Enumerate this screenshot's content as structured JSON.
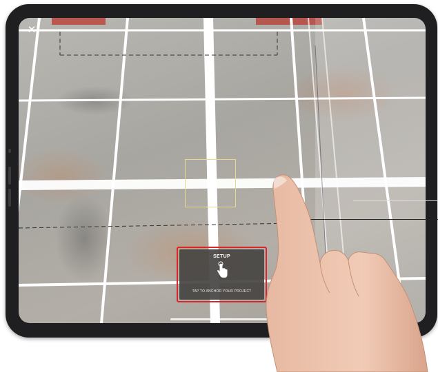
{
  "screen": {
    "close_icon": "✕",
    "setup": {
      "title": "SETUP",
      "caption": "TAP TO ANCHOR YOUR PROJECT",
      "icon": "tap-hand-icon"
    }
  },
  "colors": {
    "highlight_border": "#d8262c",
    "anchor_box": "#e6d98a",
    "grid_lines": "#ffffff",
    "card_background": "#464442"
  }
}
